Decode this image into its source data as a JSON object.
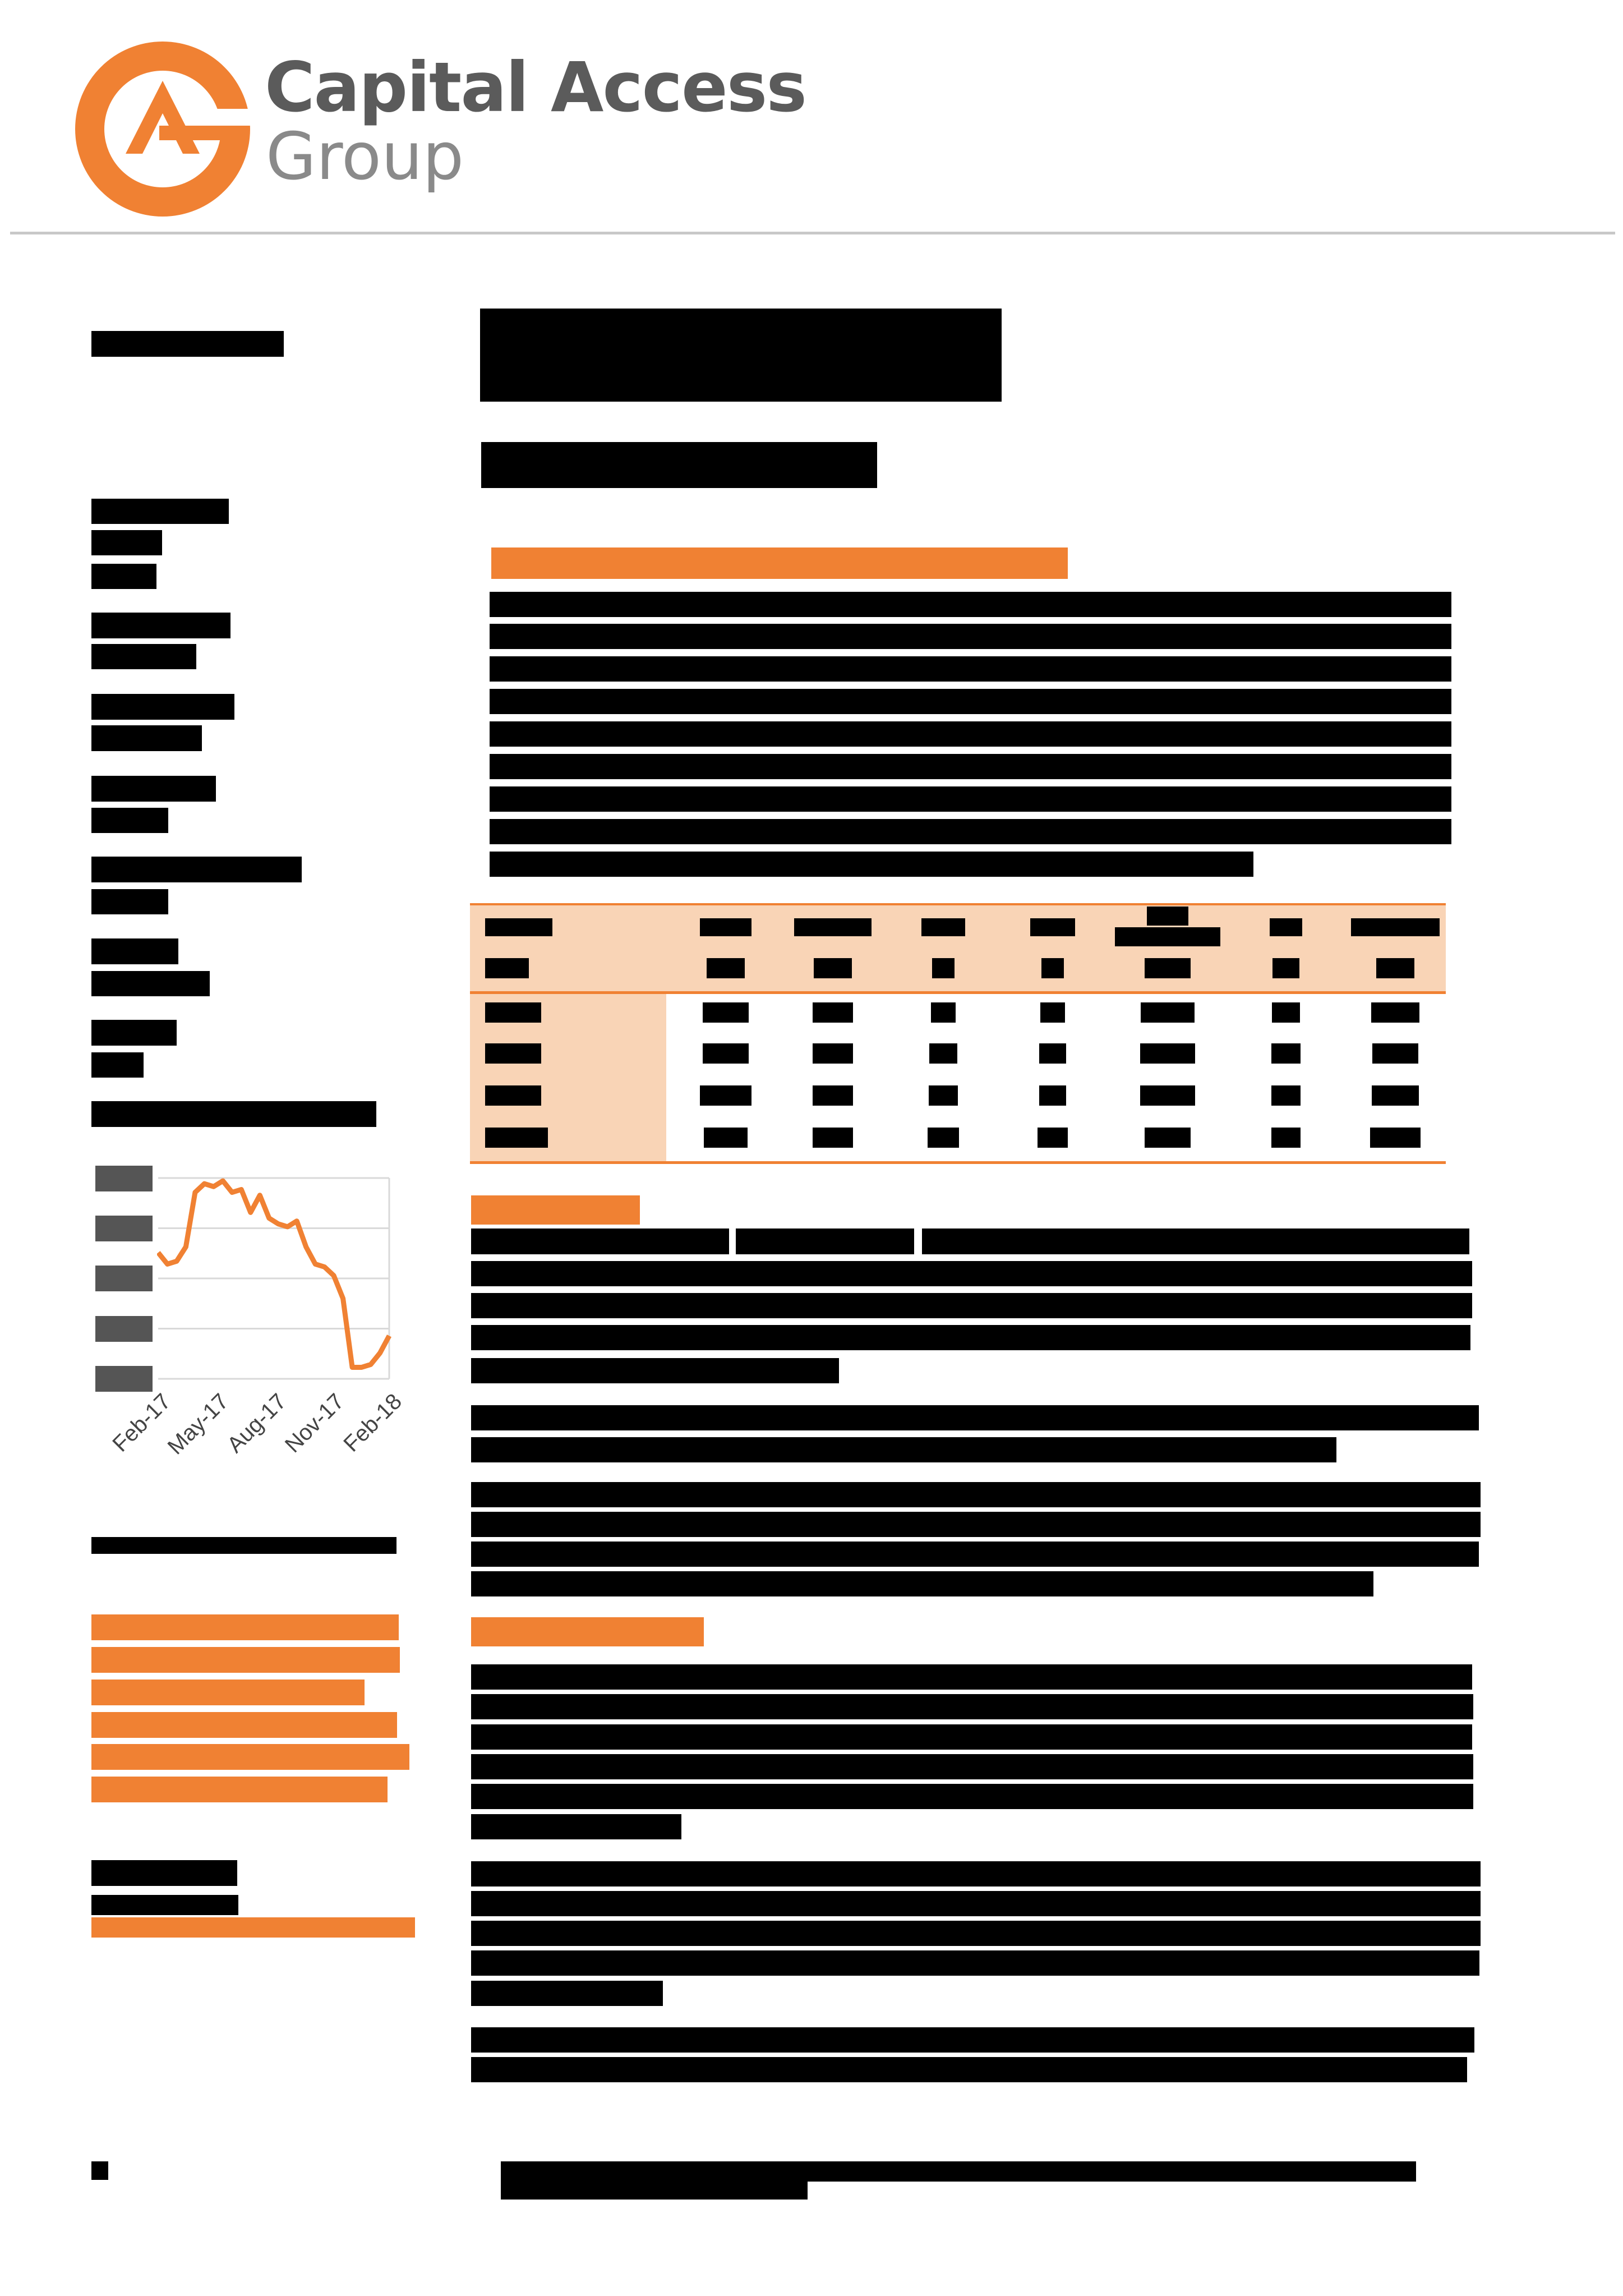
{
  "logo": {
    "line1": "Capital Access",
    "line2": "Group",
    "brand_orange": "#f08133",
    "brand_grey": "#5b5b5b"
  },
  "redaction_color": "#000000",
  "sidebar": {
    "chart": {
      "x_tick_labels": [
        "Feb-17",
        "May-17",
        "Aug-17",
        "Nov-17",
        "Feb-18"
      ],
      "line_color": "#f08133",
      "grid": true
    }
  },
  "chart_data": {
    "type": "line",
    "title": "",
    "xlabel": "",
    "ylabel": "",
    "categories": [
      "Feb-17",
      "May-17",
      "Aug-17",
      "Nov-17",
      "Feb-18"
    ],
    "y_tick_labels_redacted": true,
    "series": [
      {
        "values": [
          3.0,
          2.8,
          2.85,
          3.1,
          4.05,
          4.2,
          4.15,
          4.25,
          4.05,
          4.1,
          3.7,
          4.0,
          3.6,
          3.5,
          3.45,
          3.55,
          3.1,
          2.8,
          2.75,
          2.6,
          2.2,
          1.0,
          1.0,
          1.05,
          1.25,
          1.55
        ]
      }
    ]
  }
}
